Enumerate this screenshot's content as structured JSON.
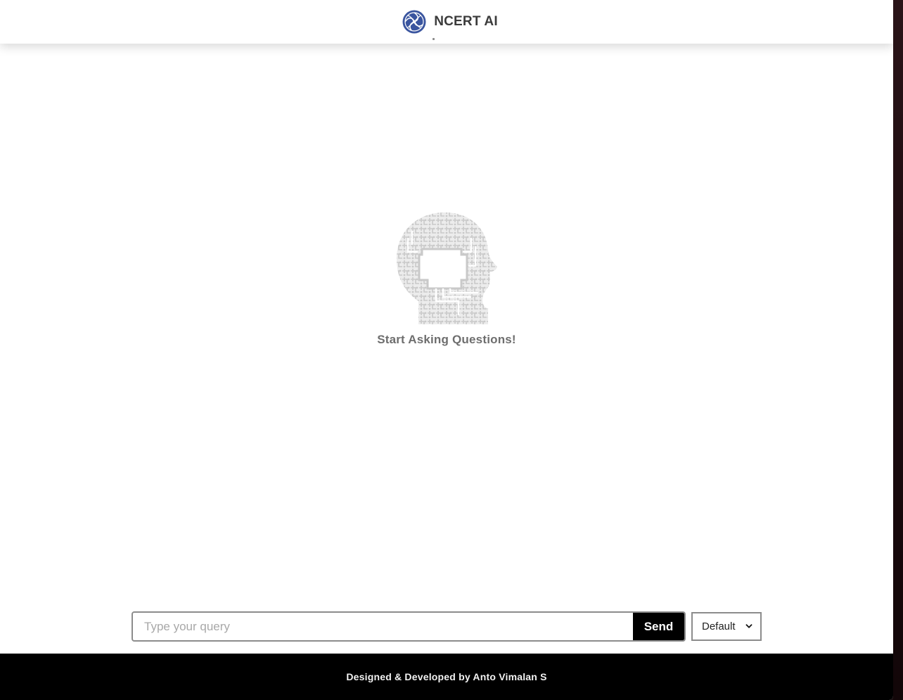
{
  "header": {
    "title": "NCERT AI",
    "logo_icon": "ncert-swirl-logo",
    "logo_color": "#3a559f"
  },
  "main": {
    "empty_state": {
      "icon": "circuit-head-icon",
      "icon_color": "#c9c9c9",
      "text": "Start Asking Questions!"
    }
  },
  "composer": {
    "placeholder": "Type your query",
    "value": "",
    "send_label": "Send",
    "send_color": "#000000"
  },
  "mode_select": {
    "selected": "Default"
  },
  "footer": {
    "text": "Designed & Developed by Anto Vimalan S",
    "background": "#000000"
  }
}
